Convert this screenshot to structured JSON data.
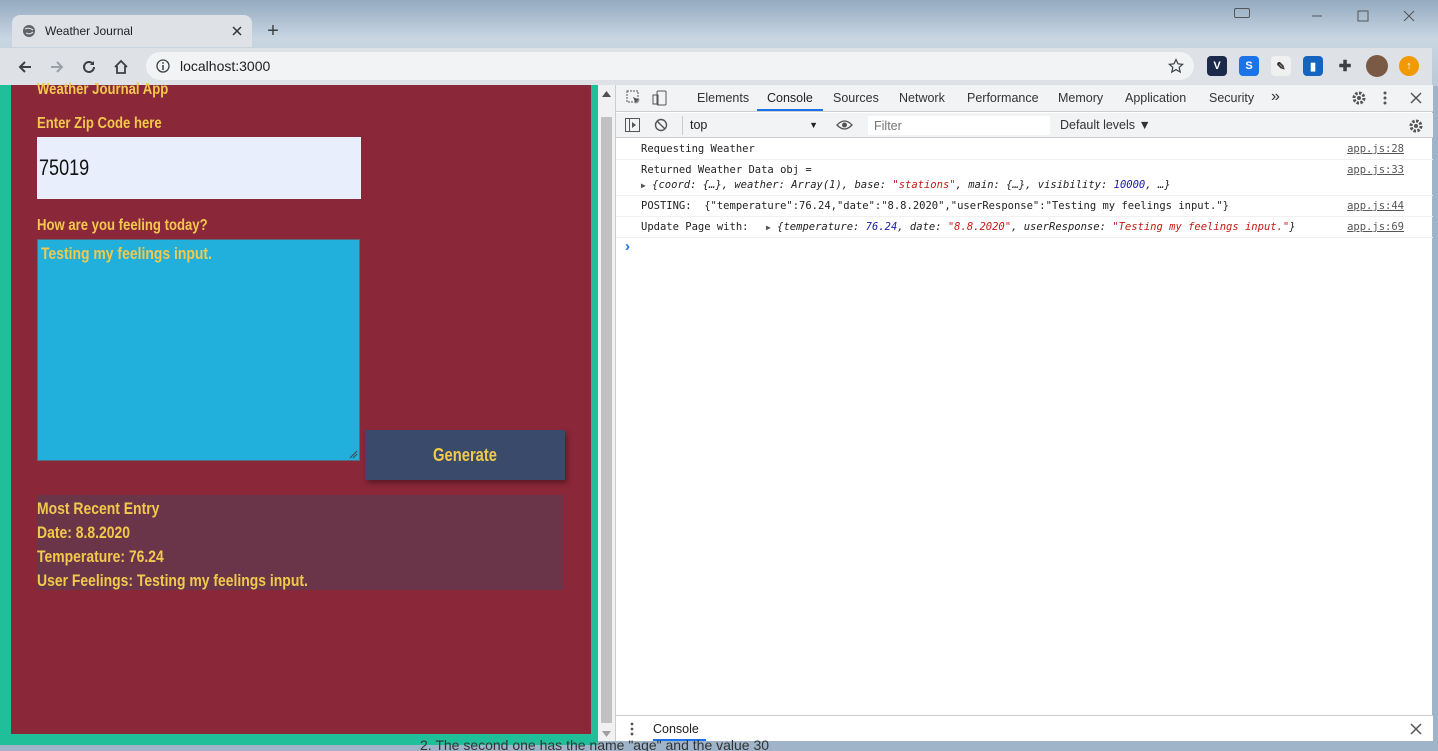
{
  "browser": {
    "tab_title": "Weather Journal",
    "url": "localhost:3000"
  },
  "app": {
    "title": "Weather Journal App",
    "zip_label": "Enter Zip Code here",
    "zip_value": "75019",
    "feelings_label": "How are you feeling today?",
    "feelings_value": "Testing my feelings input.",
    "generate_label": "Generate",
    "recent": {
      "heading": "Most Recent Entry",
      "date": "Date: 8.8.2020",
      "temperature": "Temperature: 76.24",
      "feelings": "User Feelings: Testing my feelings input."
    }
  },
  "devtools": {
    "tabs": [
      "Elements",
      "Console",
      "Sources",
      "Network",
      "Performance",
      "Memory",
      "Application",
      "Security"
    ],
    "more": "»",
    "context": "top",
    "filter_placeholder": "Filter",
    "levels": "Default levels ▼",
    "messages": {
      "m1": {
        "text": "Requesting Weather",
        "src": "app.js:28"
      },
      "m2": {
        "text": "Returned Weather Data obj =",
        "obj": {
          "a": "{coord: {…}, weather: Array(1), base: ",
          "b": "\"stations\"",
          "c": ", main: {…}, visibility: ",
          "d": "10000",
          "e": ", …}"
        },
        "src": "app.js:33"
      },
      "m3": {
        "text": "POSTING:  {\"temperature\":76.24,\"date\":\"8.8.2020\",\"userResponse\":\"Testing my feelings input.\"}",
        "src": "app.js:44"
      },
      "m4": {
        "text": "Update Page with:",
        "obj": {
          "a": "{temperature: ",
          "b": "76.24",
          "c": ", date: ",
          "d": "\"8.8.2020\"",
          "e": ", userResponse: ",
          "f": "\"Testing my feelings input.\"",
          "g": "}"
        },
        "src": "app.js:69"
      }
    },
    "prompt": "›",
    "drawer_tab": "Console"
  },
  "background_text": "2. The second one has the name \"age\" and the value 30"
}
